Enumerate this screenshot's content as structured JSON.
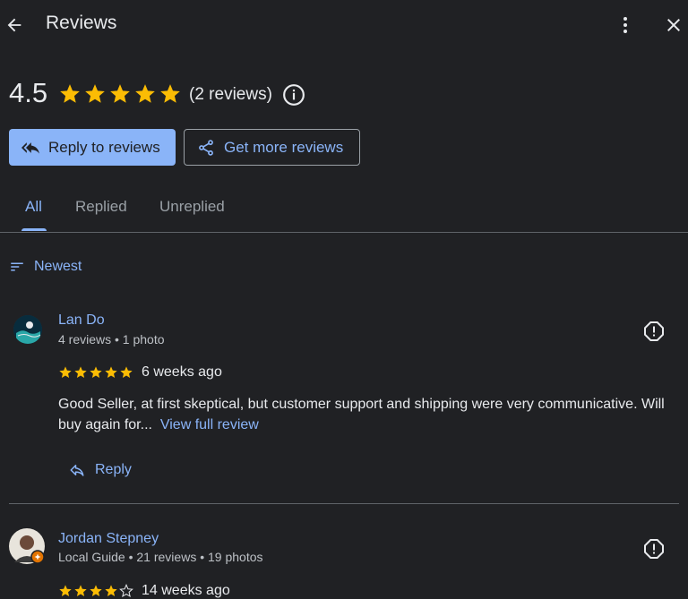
{
  "header": {
    "title": "Reviews",
    "back_icon": "arrow-left-icon",
    "more_icon": "more-vert-icon",
    "close_icon": "close-icon"
  },
  "summary": {
    "rating": "4.5",
    "stars": 5,
    "count_text": "(2 reviews)",
    "info_icon": "info-icon",
    "star_color": "#fbbc04"
  },
  "actions": {
    "reply_label": "Reply to reviews",
    "get_more_label": "Get more reviews"
  },
  "tabs": [
    {
      "label": "All",
      "active": true
    },
    {
      "label": "Replied",
      "active": false
    },
    {
      "label": "Unreplied",
      "active": false
    }
  ],
  "sort": {
    "label": "Newest"
  },
  "reviews": [
    {
      "name": "Lan Do",
      "meta": "4 reviews • 1 photo",
      "stars": 5,
      "time": "6 weeks ago",
      "text": "Good Seller, at first skeptical, but customer support and shipping were very communicative. Will buy again for...",
      "link": "View full review",
      "reply_label": "Reply"
    },
    {
      "name": "Jordan Stepney",
      "meta": "Local Guide • 21 reviews • 19 photos",
      "stars": 4,
      "time": "14 weeks ago"
    }
  ],
  "colors": {
    "background": "#202124",
    "accent": "#8ab4f8",
    "text": "#e8eaed",
    "muted": "#9aa0a6"
  }
}
